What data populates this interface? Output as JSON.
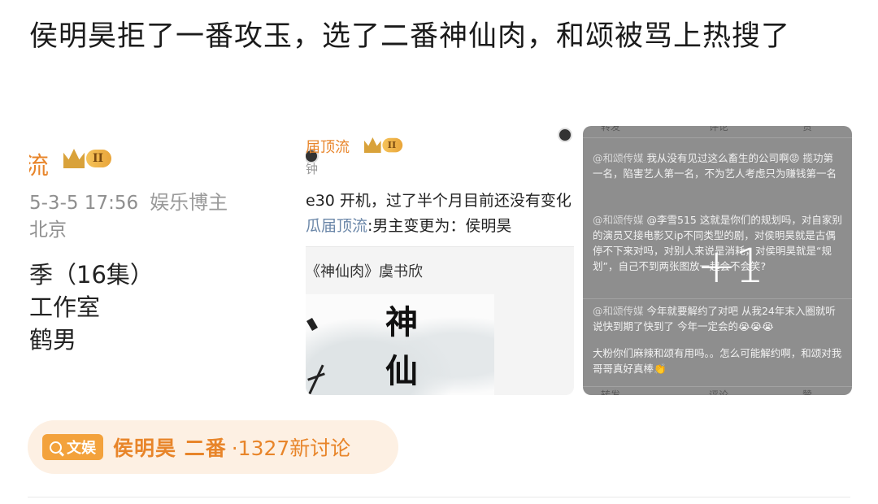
{
  "post": {
    "headline": "侯明昊拒了一番攻玉，选了二番神仙肉，和颂被骂上热搜了"
  },
  "thumbs": {
    "t1": {
      "name": "流",
      "level": "II",
      "meta_date": "5-3-5 17:56",
      "meta_role": "娱乐博主",
      "meta_loc": "北京",
      "lines": [
        "季（16集）",
        "工作室",
        "鹤男"
      ]
    },
    "t2": {
      "name": "届顶流",
      "level": "II",
      "time": "钟",
      "p1": "e30 开机，过了半个月目前还没有变化",
      "p2_tag": "瓜届顶流",
      "p2_text": ":男主变更为：侯明昊",
      "quote": "《神仙肉》虞书欣",
      "poster_chars": [
        "神",
        "仙"
      ]
    },
    "t3": {
      "overlay": "+1",
      "top_actions": [
        "转发",
        "评论",
        "赞"
      ],
      "comments": [
        {
          "user": "@和颂传媒",
          "text": "我从没有见过这么畜生的公司啊😡 揽功第一名，陷害艺人第一名，不为艺人考虑只为赚钱第一名"
        },
        {
          "user": "@和颂传媒",
          "text": "@李雪515 这就是你们的规划吗，对自家别的演员又接电影又ip不同类型的剧，对侯明昊就是古偶停不下来对吗，对别人来说是消耗，对侯明昊就是“规划”，自己不到两张图放一起会不会笑?"
        },
        {
          "user": "@和颂传媒",
          "text": "今年就要解约了对吧 从我24年末入圈就听说快到期了快到了 今年一定会的😭😭😭"
        },
        {
          "user": "",
          "text": "大粉你们麻辣和颂有用吗。。怎么可能解约啊，和颂对我哥哥真好真棒👏"
        }
      ],
      "bottom_actions": [
        "转发",
        "评论",
        "赞"
      ]
    }
  },
  "topic": {
    "badge": "文娱",
    "name": "侯明昊 二番",
    "count": "·1327新讨论"
  },
  "colors": {
    "accent": "#e8852a",
    "chip_bg": "#fdf0e3",
    "badge_bg": "#f3a23c"
  }
}
